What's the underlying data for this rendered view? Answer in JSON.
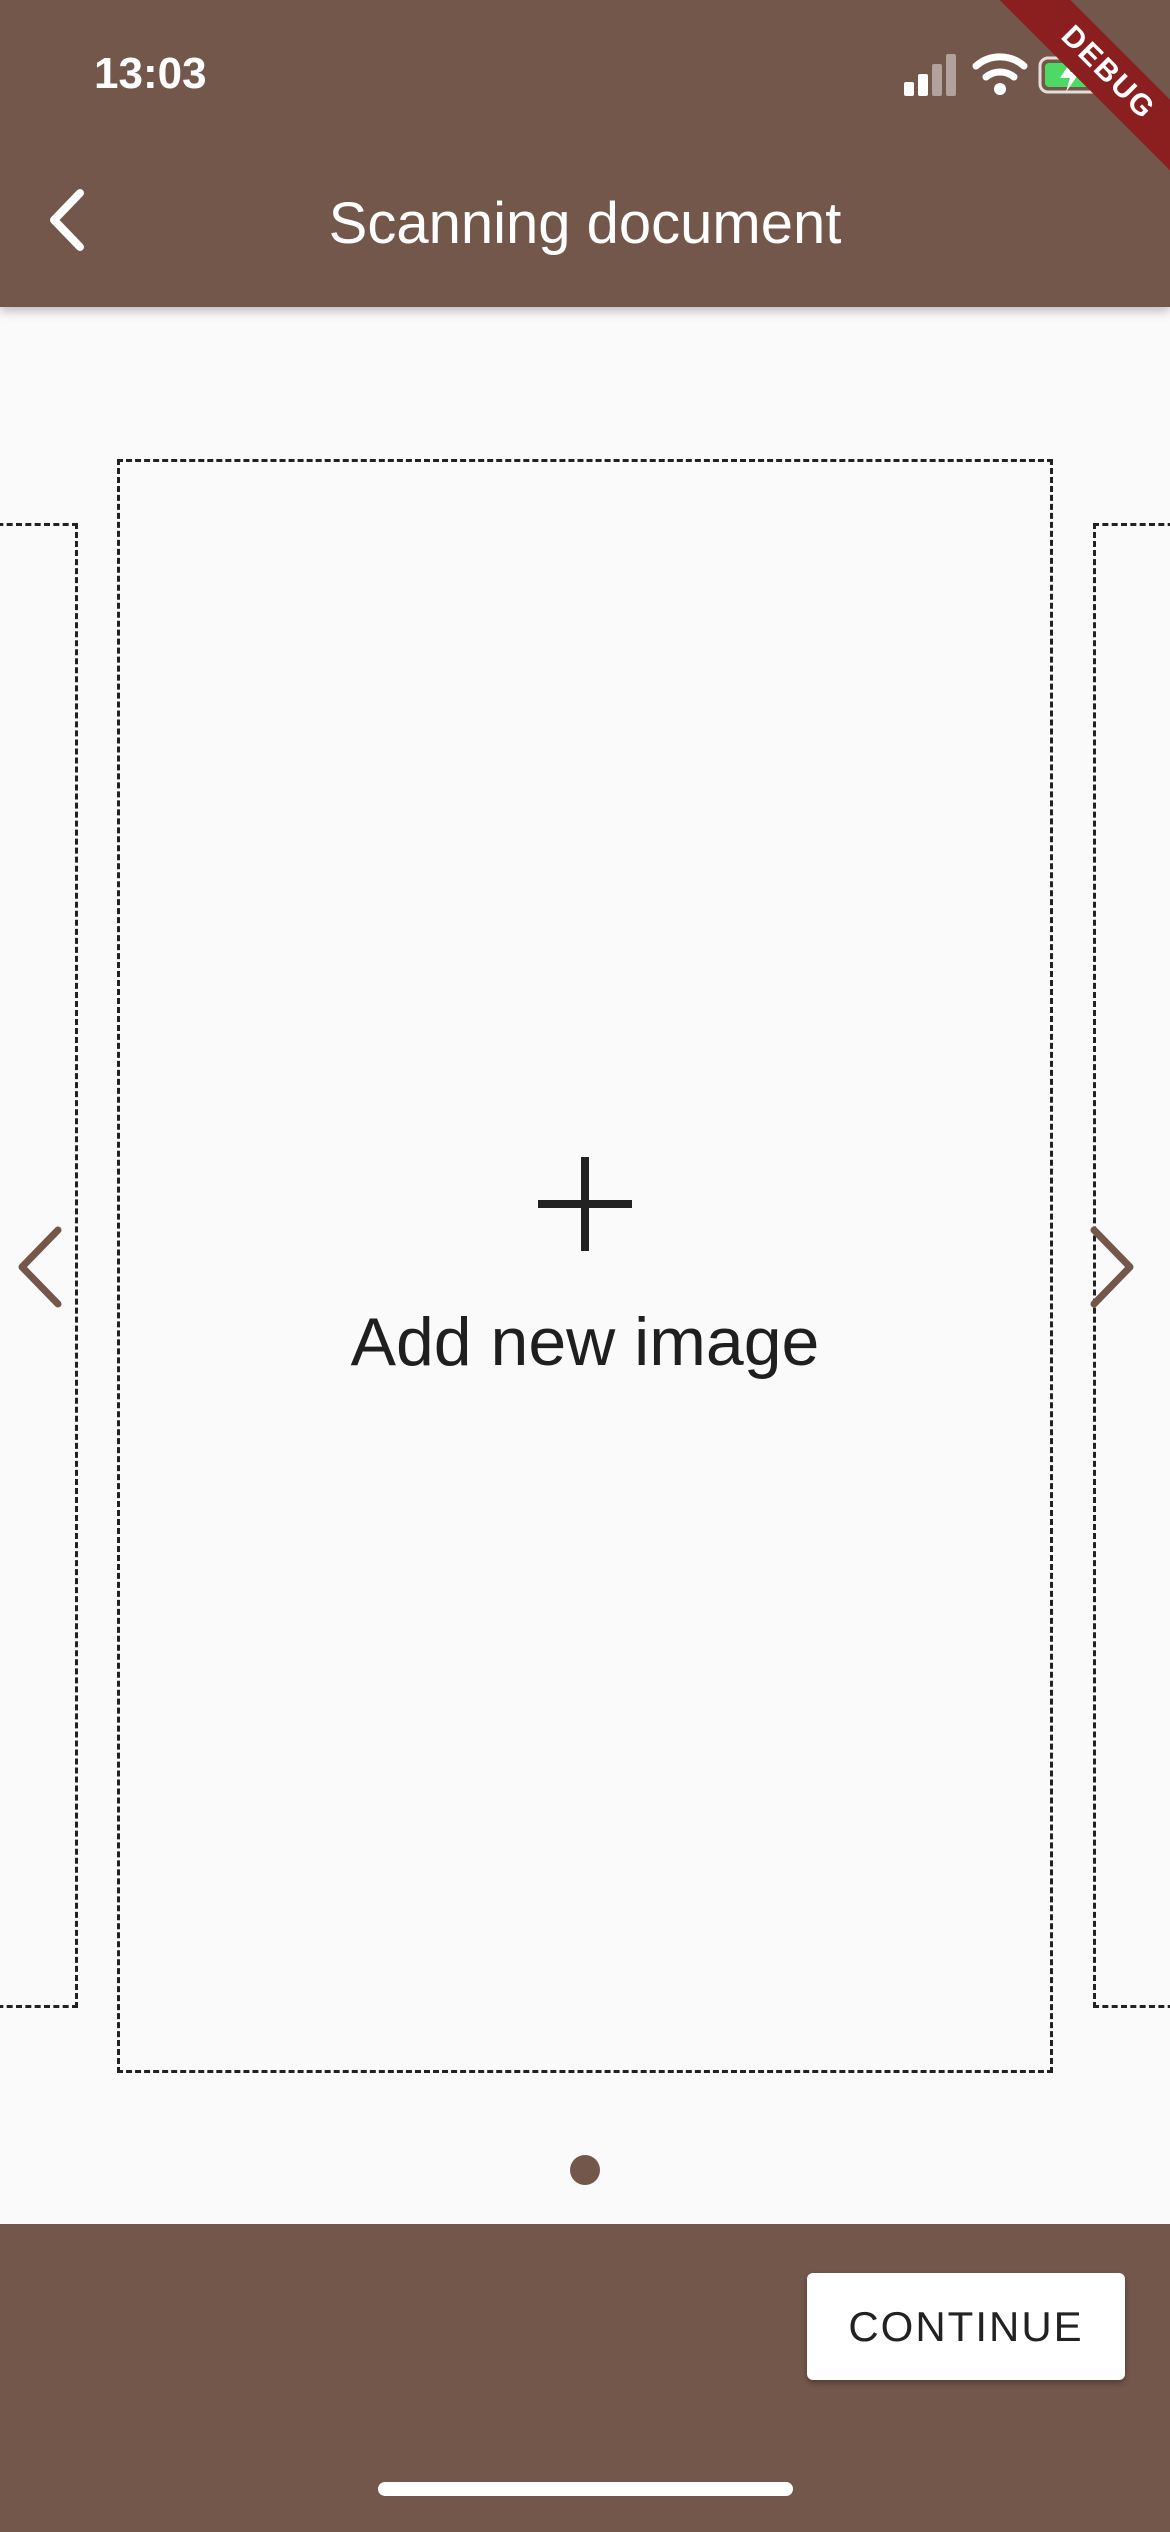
{
  "status_bar": {
    "time": "13:03",
    "icons": [
      "signal-icon",
      "wifi-icon",
      "battery-charging-icon"
    ]
  },
  "debug_banner": {
    "label": "DEBUG"
  },
  "app_bar": {
    "title": "Scanning document",
    "back_icon": "chevron-left-icon"
  },
  "carousel": {
    "add_label": "Add new image",
    "add_icon": "plus-icon",
    "prev_icon": "chevron-left-icon",
    "next_icon": "chevron-right-icon",
    "current_page": 1,
    "page_count": 1
  },
  "bottom_bar": {
    "continue_label": "CONTINUE"
  },
  "colors": {
    "brand": "#74574b",
    "background": "#fafafa",
    "debug": "#8b1f1f",
    "battery": "#4cd964"
  }
}
